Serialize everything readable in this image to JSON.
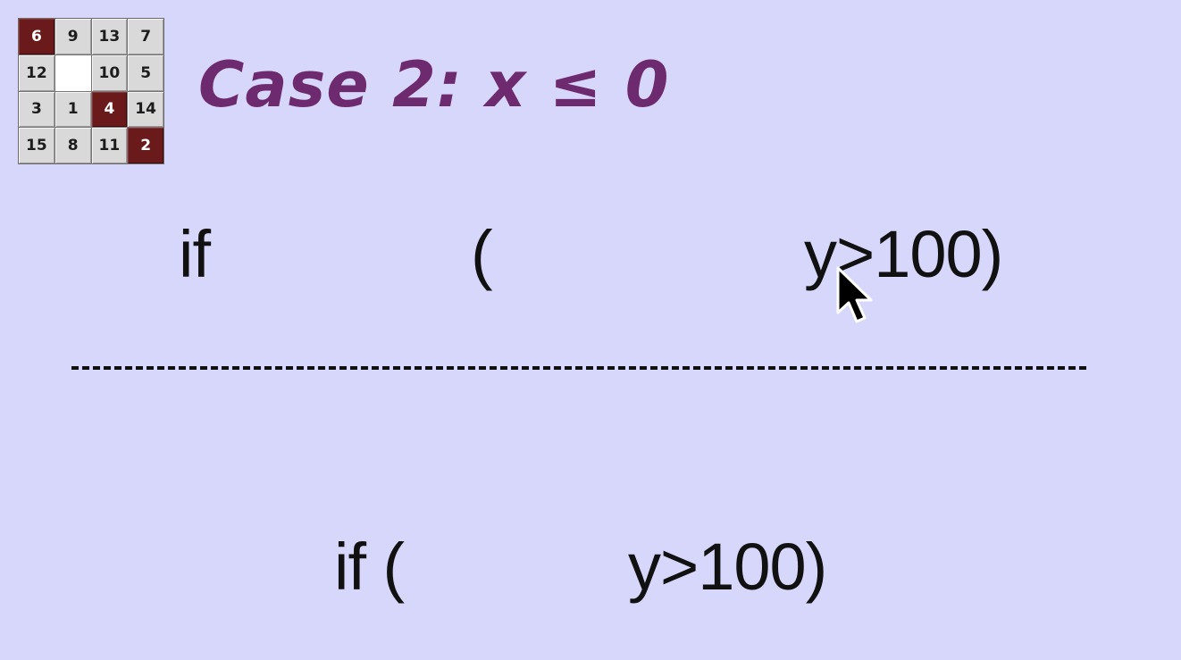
{
  "logo": {
    "tiles": [
      {
        "label": "6",
        "style": "dark"
      },
      {
        "label": "9",
        "style": "light"
      },
      {
        "label": "13",
        "style": "light"
      },
      {
        "label": "7",
        "style": "light"
      },
      {
        "label": "12",
        "style": "light"
      },
      {
        "label": "",
        "style": "blank"
      },
      {
        "label": "10",
        "style": "light"
      },
      {
        "label": "5",
        "style": "light"
      },
      {
        "label": "3",
        "style": "light"
      },
      {
        "label": "1",
        "style": "light"
      },
      {
        "label": "4",
        "style": "dark"
      },
      {
        "label": "14",
        "style": "light"
      },
      {
        "label": "15",
        "style": "light"
      },
      {
        "label": "8",
        "style": "light"
      },
      {
        "label": "11",
        "style": "light"
      },
      {
        "label": "2",
        "style": "dark"
      }
    ]
  },
  "title": "Case 2: x ≤ 0",
  "top_code": {
    "if": "if",
    "paren": "(",
    "cond": "y>100)"
  },
  "bottom_code": {
    "prefix": "if (",
    "cond": "y>100)"
  },
  "colors": {
    "background": "#d6d7fb",
    "title": "#6d2a6f",
    "tile_dark": "#6b1a1b",
    "tile_light": "#d9d9d9"
  },
  "icons": {
    "cursor": "mouse-pointer-icon"
  }
}
